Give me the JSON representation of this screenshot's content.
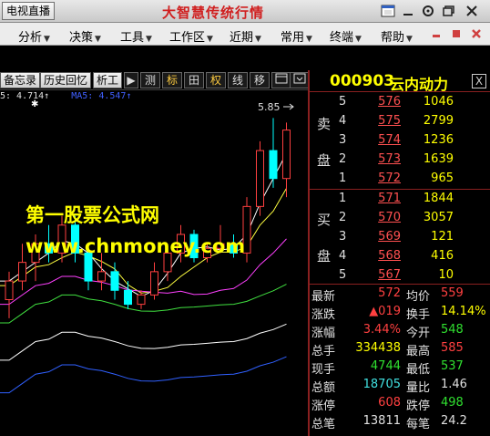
{
  "titlebar": {
    "live_button": "电视直播",
    "app_title": "大智慧传统行情"
  },
  "menu": {
    "items": [
      "分析",
      "决策",
      "工具",
      "工作区",
      "近期",
      "常用",
      "终端",
      "帮助"
    ]
  },
  "toolbar": {
    "tabs": [
      "备忘录",
      "历史回忆",
      "析工"
    ],
    "play": "▶",
    "buttons": [
      "测",
      "标",
      "田",
      "权",
      "线",
      "移"
    ]
  },
  "chart": {
    "ma_legend": [
      {
        "text": "5: 4.714↑",
        "color": "#e0e0e0"
      },
      {
        "text": "MA5: 4.547↑",
        "color": "#4060ff"
      }
    ],
    "high_label": "5.85",
    "watermark_cn": "第一股票公式网",
    "watermark_url": "www.chnmoney.com"
  },
  "quote": {
    "code": "000903",
    "name": "云内动力",
    "close": "X",
    "sell_label": [
      "卖",
      "盘"
    ],
    "buy_label": [
      "买",
      "盘"
    ],
    "sell": [
      {
        "level": "5",
        "price": "576",
        "volume": "1046"
      },
      {
        "level": "4",
        "price": "575",
        "volume": "2799"
      },
      {
        "level": "3",
        "price": "574",
        "volume": "1236"
      },
      {
        "level": "2",
        "price": "573",
        "volume": "1639"
      },
      {
        "level": "1",
        "price": "572",
        "volume": "965"
      }
    ],
    "buy": [
      {
        "level": "1",
        "price": "571",
        "volume": "1844"
      },
      {
        "level": "2",
        "price": "570",
        "volume": "3057"
      },
      {
        "level": "3",
        "price": "569",
        "volume": "121"
      },
      {
        "level": "4",
        "price": "568",
        "volume": "416"
      },
      {
        "level": "5",
        "price": "567",
        "volume": "10"
      }
    ],
    "stats": [
      {
        "l1": "最新",
        "v1": "572",
        "c1": "red",
        "l2": "均价",
        "v2": "559",
        "c2": "red"
      },
      {
        "l1": "涨跌",
        "v1": "▲019",
        "c1": "red",
        "l2": "换手",
        "v2": "14.14%",
        "c2": "yellow"
      },
      {
        "l1": "涨幅",
        "v1": "3.44%",
        "c1": "red",
        "l2": "今开",
        "v2": "548",
        "c2": "green"
      },
      {
        "l1": "总手",
        "v1": "334438",
        "c1": "yellow",
        "l2": "最高",
        "v2": "585",
        "c2": "red"
      },
      {
        "l1": "现手",
        "v1": "4744",
        "c1": "green",
        "l2": "最低",
        "v2": "537",
        "c2": "green"
      },
      {
        "l1": "总额",
        "v1": "18705",
        "c1": "cyan",
        "l2": "量比",
        "v2": "1.46",
        "c2": "white"
      },
      {
        "l1": "涨停",
        "v1": "608",
        "c1": "red",
        "l2": "跌停",
        "v2": "498",
        "c2": "green"
      },
      {
        "l1": "总笔",
        "v1": "13811",
        "c1": "white",
        "l2": "每笔",
        "v2": "24.2",
        "c2": "white"
      }
    ]
  },
  "colors": {
    "up": "#ff4040",
    "down": "#00ffff",
    "ma_white": "#ffffff",
    "ma_yellow": "#ffff40",
    "ma_magenta": "#ff40ff",
    "ma_green": "#40e040",
    "ma_blue": "#3060ff"
  },
  "chart_data": {
    "type": "candlestick",
    "candles": [
      {
        "o": 3.9,
        "h": 4.2,
        "l": 3.7,
        "c": 4.1
      },
      {
        "o": 4.1,
        "h": 4.5,
        "l": 4.0,
        "c": 4.3
      },
      {
        "o": 4.3,
        "h": 4.6,
        "l": 4.1,
        "c": 4.5
      },
      {
        "o": 4.5,
        "h": 4.7,
        "l": 4.3,
        "c": 4.4
      },
      {
        "o": 4.4,
        "h": 4.8,
        "l": 4.3,
        "c": 4.7
      },
      {
        "o": 4.7,
        "h": 4.8,
        "l": 4.3,
        "c": 4.4
      },
      {
        "o": 4.4,
        "h": 4.5,
        "l": 4.0,
        "c": 4.1
      },
      {
        "o": 4.1,
        "h": 4.4,
        "l": 4.0,
        "c": 4.2
      },
      {
        "o": 4.2,
        "h": 4.3,
        "l": 3.9,
        "c": 4.0
      },
      {
        "o": 4.0,
        "h": 4.1,
        "l": 3.8,
        "c": 3.85
      },
      {
        "o": 3.85,
        "h": 4.0,
        "l": 3.8,
        "c": 3.95
      },
      {
        "o": 3.95,
        "h": 4.3,
        "l": 3.9,
        "c": 4.2
      },
      {
        "o": 4.2,
        "h": 4.5,
        "l": 4.1,
        "c": 4.4
      },
      {
        "o": 4.4,
        "h": 4.7,
        "l": 4.3,
        "c": 4.6
      },
      {
        "o": 4.6,
        "h": 4.65,
        "l": 4.3,
        "c": 4.35
      },
      {
        "o": 4.35,
        "h": 4.5,
        "l": 4.3,
        "c": 4.45
      },
      {
        "o": 4.45,
        "h": 4.7,
        "l": 4.4,
        "c": 4.5
      },
      {
        "o": 4.5,
        "h": 4.6,
        "l": 4.35,
        "c": 4.4
      },
      {
        "o": 4.4,
        "h": 5.0,
        "l": 4.3,
        "c": 4.9
      },
      {
        "o": 4.9,
        "h": 5.6,
        "l": 4.8,
        "c": 5.5
      },
      {
        "o": 5.5,
        "h": 5.85,
        "l": 5.1,
        "c": 5.2
      },
      {
        "o": 5.2,
        "h": 5.8,
        "l": 5.0,
        "c": 5.72
      }
    ]
  }
}
